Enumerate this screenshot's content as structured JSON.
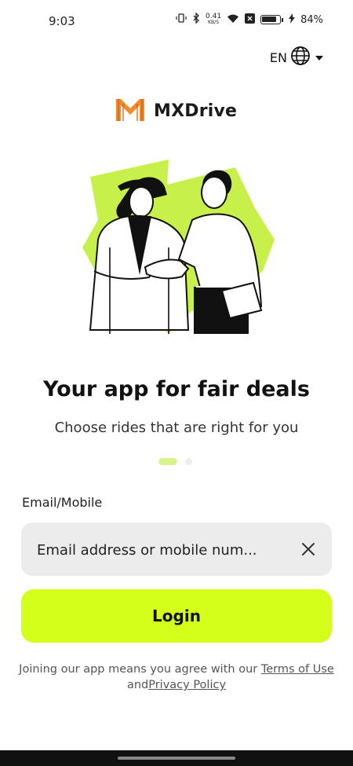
{
  "status_bar": {
    "time": "9:03",
    "speed_value": "0.41",
    "speed_unit": "KB/S",
    "battery_percent": "84%"
  },
  "language": {
    "code": "EN"
  },
  "brand": {
    "name": "MXDrive"
  },
  "hero": {
    "title": "Your app for fair deals",
    "subtitle": "Choose rides that are right for you"
  },
  "carousel": {
    "total": 2,
    "active": 1
  },
  "form": {
    "email_label": "Email/Mobile",
    "email_placeholder": "Email address or mobile num...",
    "login_label": "Login"
  },
  "terms": {
    "prefix": "Joining our app means you agree with our ",
    "terms_link": "Terms of Use",
    "connector": " and",
    "privacy_link": "Privacy Policy"
  },
  "colors": {
    "accent": "#d4ff1b",
    "logo_orange": "#f08a2a",
    "illustration_green": "#c8f04a"
  },
  "icons": [
    "vibrate-icon",
    "bluetooth-icon",
    "wifi-icon",
    "close-box-icon",
    "battery-icon",
    "charging-icon",
    "globe-icon",
    "chevron-down-icon",
    "clear-icon"
  ]
}
